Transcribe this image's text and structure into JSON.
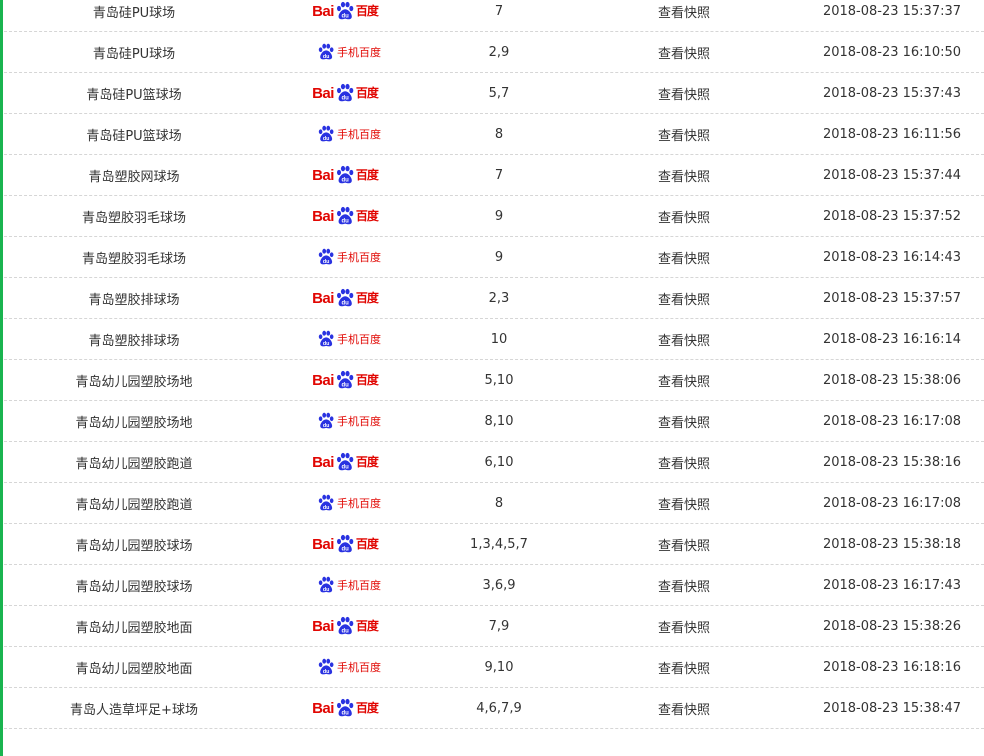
{
  "colors": {
    "accent_bar": "#19b44f",
    "baidu_red": "#e10602",
    "baidu_blue": "#2932e1",
    "text": "#333333"
  },
  "engines": {
    "pc": {
      "left": "Bai",
      "right": "百度"
    },
    "mobile": {
      "text": "手机百度"
    }
  },
  "snapshot_label": "查看快照",
  "rows": [
    {
      "keyword": "青岛硅PU球场",
      "engine": "pc",
      "rank": "7",
      "time": "2018-08-23 15:37:37"
    },
    {
      "keyword": "青岛硅PU球场",
      "engine": "mobile",
      "rank": "2,9",
      "time": "2018-08-23 16:10:50"
    },
    {
      "keyword": "青岛硅PU篮球场",
      "engine": "pc",
      "rank": "5,7",
      "time": "2018-08-23 15:37:43"
    },
    {
      "keyword": "青岛硅PU篮球场",
      "engine": "mobile",
      "rank": "8",
      "time": "2018-08-23 16:11:56"
    },
    {
      "keyword": "青岛塑胶网球场",
      "engine": "pc",
      "rank": "7",
      "time": "2018-08-23 15:37:44"
    },
    {
      "keyword": "青岛塑胶羽毛球场",
      "engine": "pc",
      "rank": "9",
      "time": "2018-08-23 15:37:52"
    },
    {
      "keyword": "青岛塑胶羽毛球场",
      "engine": "mobile",
      "rank": "9",
      "time": "2018-08-23 16:14:43"
    },
    {
      "keyword": "青岛塑胶排球场",
      "engine": "pc",
      "rank": "2,3",
      "time": "2018-08-23 15:37:57"
    },
    {
      "keyword": "青岛塑胶排球场",
      "engine": "mobile",
      "rank": "10",
      "time": "2018-08-23 16:16:14"
    },
    {
      "keyword": "青岛幼儿园塑胶场地",
      "engine": "pc",
      "rank": "5,10",
      "time": "2018-08-23 15:38:06"
    },
    {
      "keyword": "青岛幼儿园塑胶场地",
      "engine": "mobile",
      "rank": "8,10",
      "time": "2018-08-23 16:17:08"
    },
    {
      "keyword": "青岛幼儿园塑胶跑道",
      "engine": "pc",
      "rank": "6,10",
      "time": "2018-08-23 15:38:16"
    },
    {
      "keyword": "青岛幼儿园塑胶跑道",
      "engine": "mobile",
      "rank": "8",
      "time": "2018-08-23 16:17:08"
    },
    {
      "keyword": "青岛幼儿园塑胶球场",
      "engine": "pc",
      "rank": "1,3,4,5,7",
      "time": "2018-08-23 15:38:18"
    },
    {
      "keyword": "青岛幼儿园塑胶球场",
      "engine": "mobile",
      "rank": "3,6,9",
      "time": "2018-08-23 16:17:43"
    },
    {
      "keyword": "青岛幼儿园塑胶地面",
      "engine": "pc",
      "rank": "7,9",
      "time": "2018-08-23 15:38:26"
    },
    {
      "keyword": "青岛幼儿园塑胶地面",
      "engine": "mobile",
      "rank": "9,10",
      "time": "2018-08-23 16:18:16"
    },
    {
      "keyword": "青岛人造草坪足+球场",
      "engine": "pc",
      "rank": "4,6,7,9",
      "time": "2018-08-23 15:38:47"
    }
  ]
}
